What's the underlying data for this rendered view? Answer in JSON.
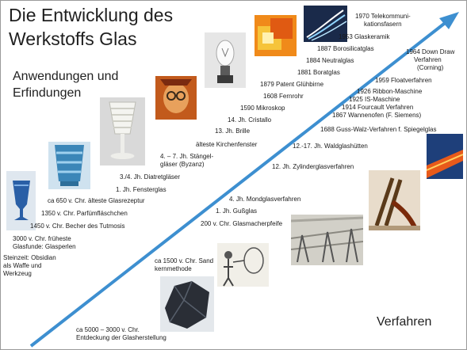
{
  "title_line1": "Die Entwicklung des",
  "title_line2": "Werkstoffs Glas",
  "anwendungen_label": "Anwendungen und",
  "erfindungen_label": "Erfindungen",
  "verfahren_label": "Verfahren",
  "colors": {
    "arrow": "#3d8fd0",
    "text": "#1a1a1a",
    "frame": "#9a9a9a"
  },
  "upper_labels": [
    "Steinzeit: Obsidian",
    "als Waffe und",
    "Werkzeug",
    "3000 v. Chr. früheste",
    "Glasfunde: Glasperlen",
    "1450 v. Chr. Becher des Tutmosis",
    "1350 v. Chr. Parfümfläschchen",
    "ca 650 v. Chr. älteste Glasrezeptur",
    "1. Jh. Fensterglas",
    "3./4. Jh. Diatretgläser",
    "4. – 7. Jh. Stängel-",
    "gläser (Byzanz)",
    "älteste Kirchenfenster",
    "13. Jh. Brille",
    "14. Jh. Cristallo",
    "1590 Mikroskop",
    "1608 Fernrohr",
    "1879 Patent Glühbirne",
    "1881 Boratglas",
    "1884 Neutralglas",
    "1887 Borosilicatglas",
    "1953 Glaskeramik",
    "1970 Telekommuni-",
    "kationsfasern"
  ],
  "lower_labels": [
    "ca 5000 – 3000 v. Chr.",
    "Entdeckung der Glasherstellung",
    "ca 1500 v. Chr. Sand",
    "kernmethode",
    "200 v. Chr. Glasmacherpfeife",
    "1. Jh. Gußglas",
    "4. Jh. Mondglasverfahren",
    "12. Jh. Zylinderglasverfahren",
    "12.-17. Jh. Waldglashütten",
    "1688 Guss-Walz-Verfahren f. Spiegelglas",
    "1867 Wannenofen (F. Siemens)",
    "1914 Fourcault Verfahren",
    "1925 IS-Maschine",
    "1926 Ribbon-Maschine",
    "1959 Floatverfahren",
    "1964 Down Draw",
    "Verfahren",
    "(Corning)"
  ]
}
